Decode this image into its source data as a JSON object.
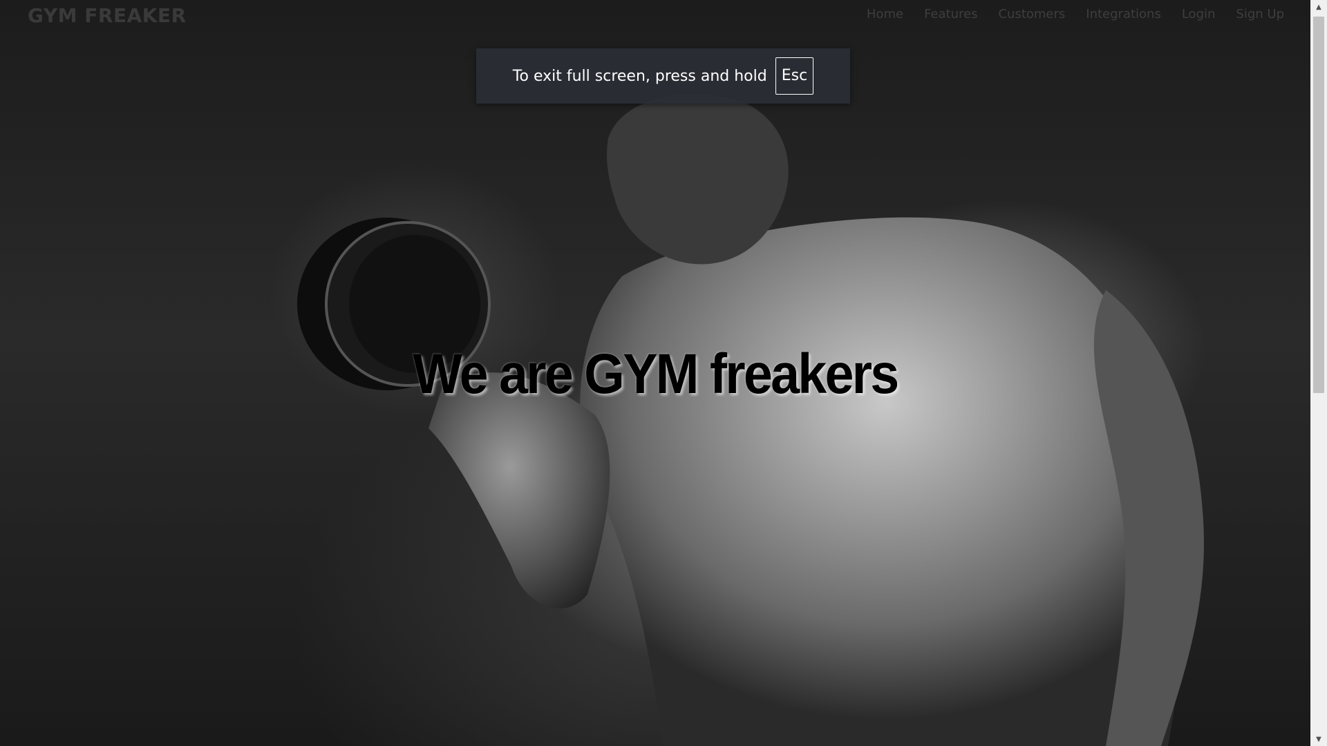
{
  "navbar": {
    "brand": "GYM FREAKER",
    "links": [
      "Home",
      "Features",
      "Customers",
      "Integrations",
      "Login",
      "Sign Up"
    ]
  },
  "fullscreen_notice": {
    "text": "To exit full screen, press and hold",
    "key": "Esc"
  },
  "hero": {
    "title": "We are GYM freakers",
    "background_image": "grayscale-bodybuilder-dumbbell-curl"
  },
  "scrollbar": {
    "up_icon": "triangle-up-icon",
    "down_icon": "triangle-down-icon",
    "position_fraction": 0
  },
  "colors": {
    "toast_bg": "#2a2e34",
    "nav_text": "#3e3e3e",
    "hero_text": "#000000"
  }
}
